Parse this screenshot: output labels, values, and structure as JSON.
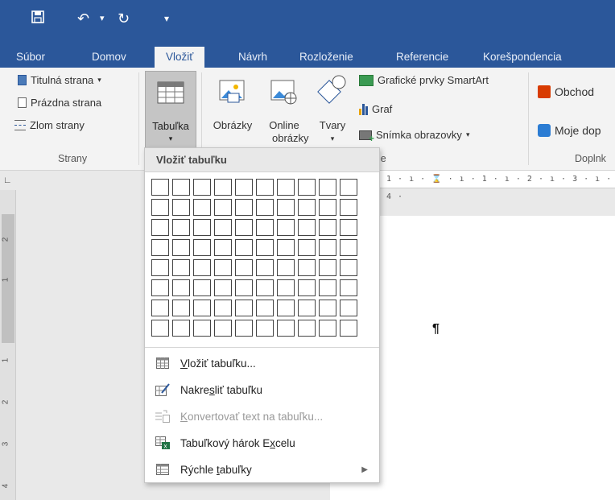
{
  "quick_access": {
    "save_icon": "save-icon",
    "undo_icon": "undo-icon",
    "redo_icon": "redo-icon",
    "customize_icon": "customize-icon"
  },
  "tabs": [
    "Súbor",
    "Domov",
    "Vložiť",
    "Návrh",
    "Rozloženie",
    "Referencie",
    "Korešpondencia"
  ],
  "active_tab": "Vložiť",
  "ribbon": {
    "pages": {
      "cover_page": "Titulná strana",
      "blank_page": "Prázdna strana",
      "page_break": "Zlom strany",
      "group_label": "Strany"
    },
    "table_button": "Tabuľka",
    "pictures": "Obrázky",
    "online_pictures_1": "Online",
    "online_pictures_2": "obrázky",
    "shapes": "Tvary",
    "smartart": "Grafické prvky SmartArt",
    "chart": "Graf",
    "screenshot": "Snímka obrazovky",
    "illustrations_label_tail": "ie",
    "store": "Obchod",
    "my_addins": "Moje dop",
    "addins_label": "Doplnk"
  },
  "ruler_text": "1 · ı · ⌛ · ı · 1 · ı · 2 · ı · 3 · ı · 4 ·",
  "left_ruler_numbers": [
    "2",
    "1",
    "1",
    "2",
    "3",
    "4"
  ],
  "pilcrow": "¶",
  "dropdown": {
    "title": "Vložiť tabuľku",
    "grid": {
      "rows": 8,
      "cols": 10
    },
    "items": [
      {
        "pre": "",
        "u": "V",
        "post": "ložiť tabuľku...",
        "icon": "insert-table-icon",
        "disabled": false
      },
      {
        "pre": "Nakre",
        "u": "s",
        "post": "liť tabuľku",
        "icon": "draw-table-icon",
        "disabled": false
      },
      {
        "pre": "",
        "u": "K",
        "post": "onvertovať text na tabuľku...",
        "icon": "convert-text-icon",
        "disabled": true
      },
      {
        "pre": "Tabuľkový hárok E",
        "u": "x",
        "post": "celu",
        "icon": "excel-sheet-icon",
        "disabled": false
      },
      {
        "pre": "Rýchle ",
        "u": "t",
        "post": "abuľky",
        "icon": "quick-tables-icon",
        "disabled": false
      }
    ]
  }
}
